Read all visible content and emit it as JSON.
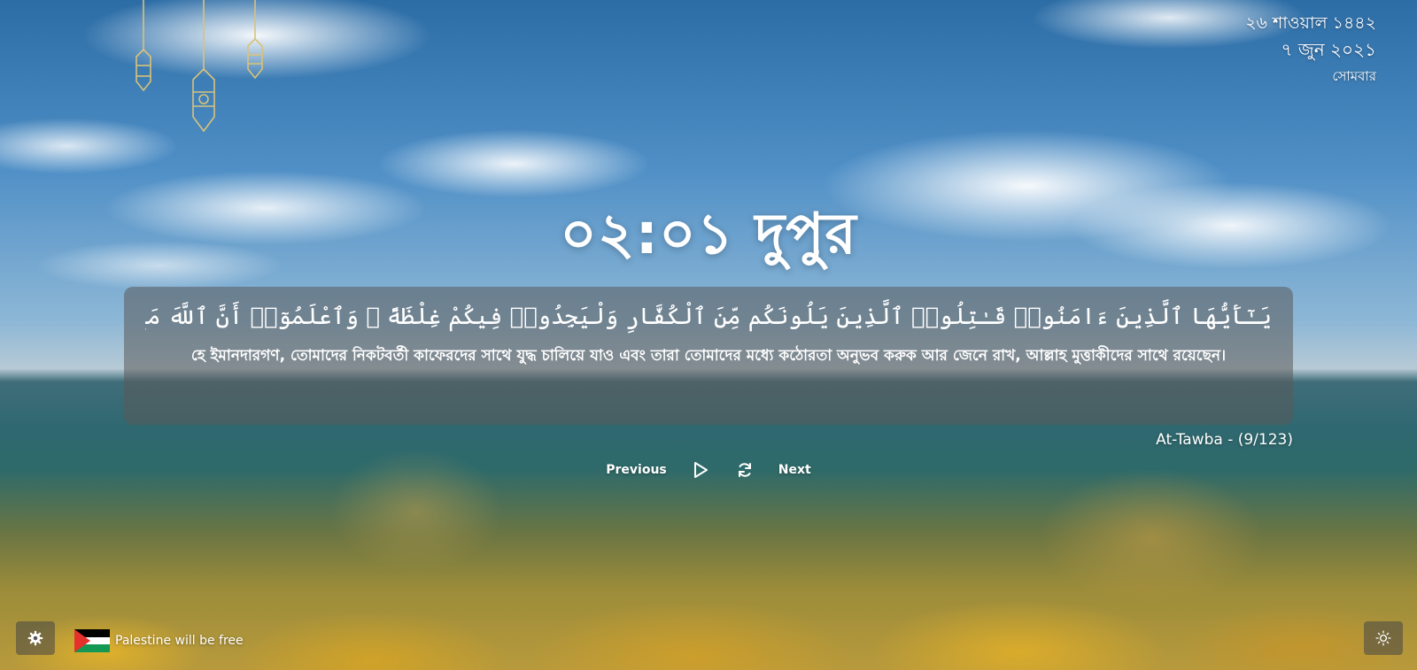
{
  "date": {
    "hijri": "২৬ শাওয়াল ১৪৪২",
    "gregorian": "৭ জুন ২০২১",
    "weekday": "সোমবার"
  },
  "clock": {
    "time": "০২:০১ দুপুর"
  },
  "verse": {
    "arabic": "يَـٰٓأَيُّهَا ٱلَّذِينَ ءَامَنُوا۟ قَـٰتِلُوا۟ ٱلَّذِينَ يَلُونَكُم مِّنَ ٱلْكُفَّارِ وَلْيَجِدُوا۟ فِيكُمْ غِلْظَةً ۚ وَٱعْلَمُوٓا۟ أَنَّ ٱللَّهَ مَعَ ٱلْمُتَّقِينَ",
    "translation": "হে ইমানদারগণ, তোমাদের নিকটবর্তী কাফেরদের সাথে যুদ্ধ চালিয়ে যাও এবং তারা তোমাদের মধ্যে কঠোরতা অনুভব করুক আর জেনে রাখ, আল্লাহ মুত্তাকীদের সাথে রয়েছেন।",
    "reference": "At-Tawba - (9/123)"
  },
  "controls": {
    "previous_label": "Previous",
    "next_label": "Next",
    "play_icon": "play-icon",
    "refresh_icon": "refresh-icon"
  },
  "footer": {
    "settings_icon": "gear-icon",
    "palestine_text": "Palestine will be free",
    "theme_icon": "sun-icon"
  },
  "colors": {
    "card_background": "rgba(90,90,90,0.55)",
    "text": "#ffffff",
    "lantern": "#d9c27a",
    "flag_red": "#e4312b",
    "flag_green": "#149954"
  }
}
